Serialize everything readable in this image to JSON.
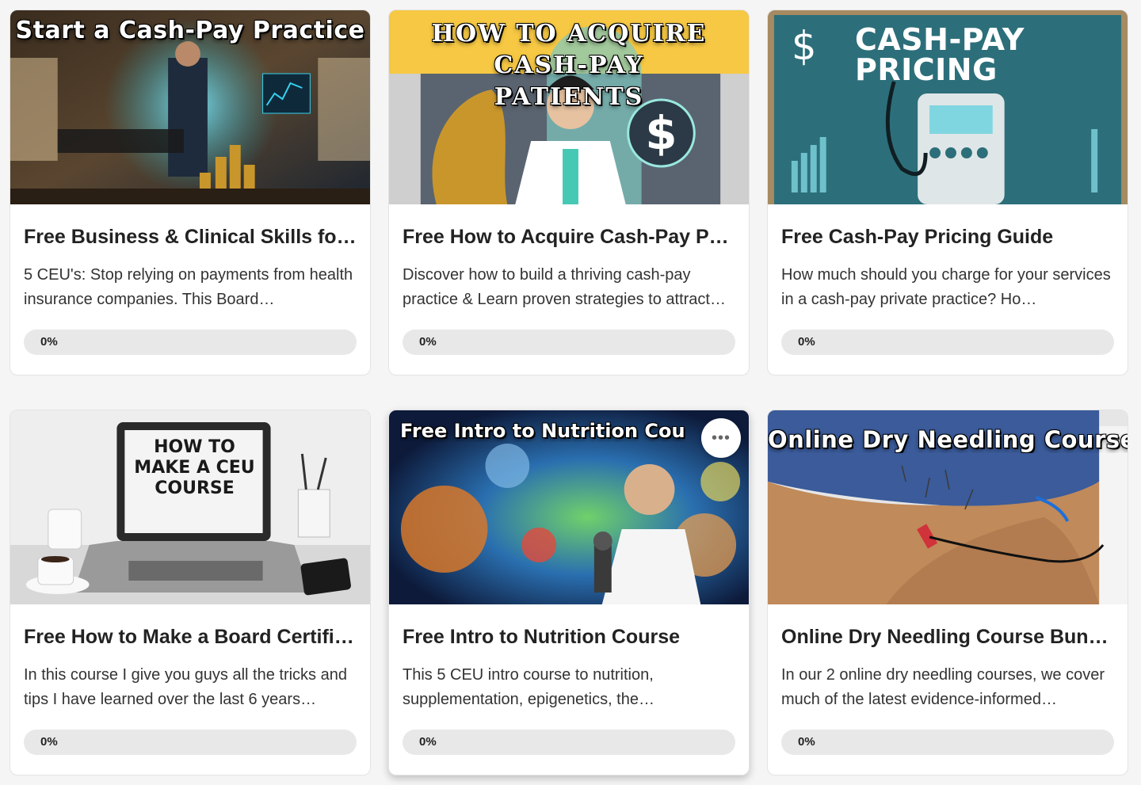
{
  "courses": [
    {
      "thumb_title": "Start a Cash-Pay Practice",
      "title": "Free Business & Clinical Skills for ...",
      "description": "5 CEU's: Stop relying on payments from health insurance companies. This Board…",
      "progress": 0,
      "progress_label": "0%",
      "accent": "#1fa6b8"
    },
    {
      "thumb_title": "How to Acquire Cash-Pay Patients",
      "title": "Free How to Acquire Cash-Pay Pa…",
      "description": "Discover how to build a thriving cash-pay practice & Learn proven strategies to attract…",
      "progress": 0,
      "progress_label": "0%",
      "accent": "#f6c843"
    },
    {
      "thumb_title": "CASH-PAY PRICING",
      "title": "Free Cash-Pay Pricing Guide",
      "description": "How much should you charge for your services in a cash-pay private practice? Ho…",
      "progress": 0,
      "progress_label": "0%",
      "accent": "#2c6f7a"
    },
    {
      "thumb_title": "HOW TO MAKE A CEU COURSE",
      "title": "Free How to Make a Board Certifie…",
      "description": "In this course I give you guys all the tricks and tips I have learned over the last 6 years…",
      "progress": 0,
      "progress_label": "0%",
      "accent": "#e9e9e9"
    },
    {
      "thumb_title": "Free Intro to Nutrition Cou",
      "title": "Free Intro to Nutrition Course",
      "description": "This 5 CEU intro course to nutrition, supplementation, epigenetics, the…",
      "progress": 0,
      "progress_label": "0%",
      "accent": "#2a6fb0"
    },
    {
      "thumb_title": "Online Dry Needling Courses",
      "title": "Online Dry Needling Course Bundl…",
      "description": "In our 2 online dry needling courses, we cover much of the latest evidence-informed…",
      "progress": 0,
      "progress_label": "0%",
      "accent": "#c08a5a"
    }
  ],
  "more_button_label": "•••"
}
